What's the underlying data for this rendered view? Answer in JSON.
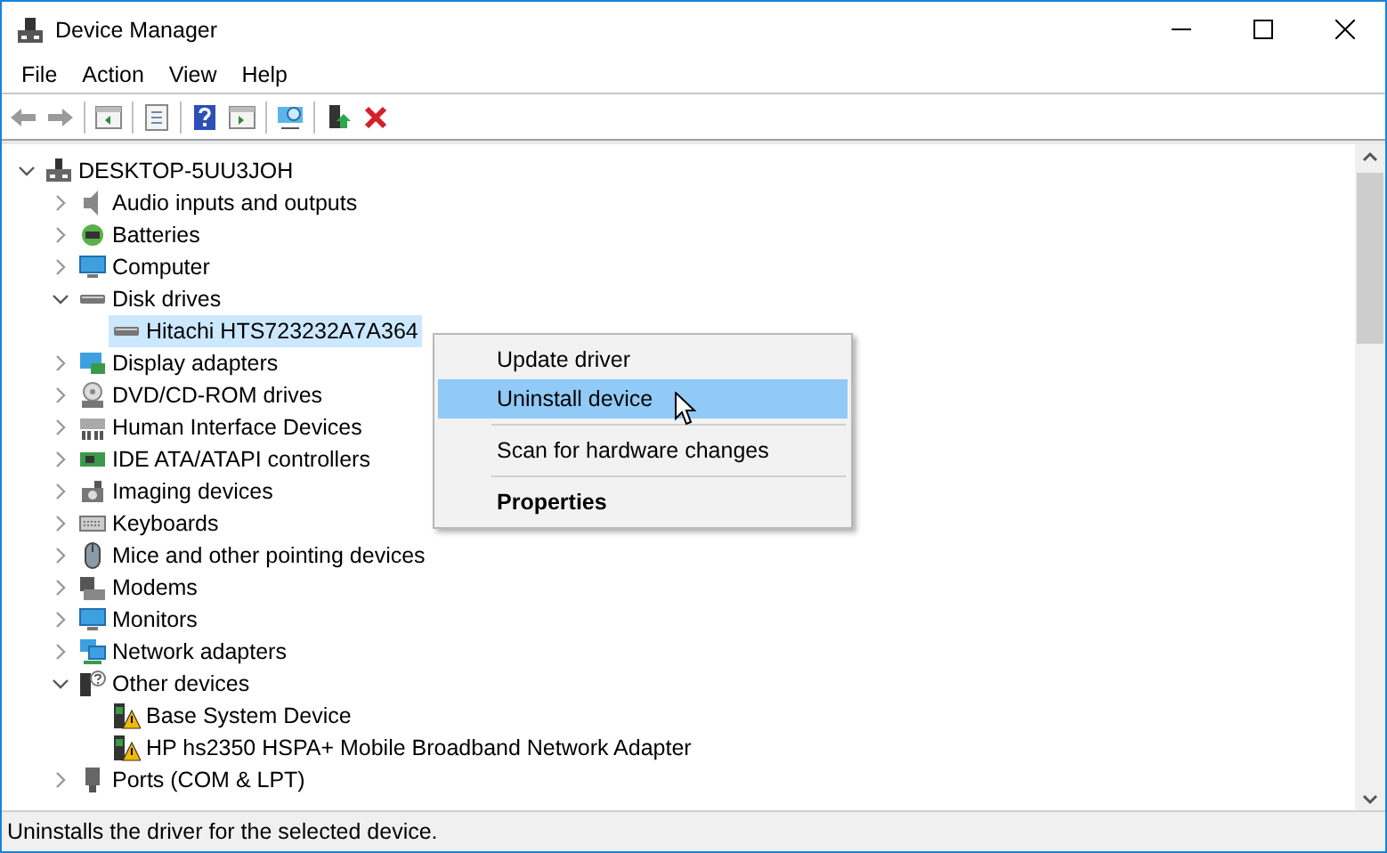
{
  "window": {
    "title": "Device Manager"
  },
  "menu": [
    {
      "label": "File"
    },
    {
      "label": "Action"
    },
    {
      "label": "View"
    },
    {
      "label": "Help"
    }
  ],
  "tree": {
    "label": "DESKTOP-5UU3JOH",
    "expanded": true,
    "selected": false,
    "children": [
      {
        "label": "Audio inputs and outputs",
        "expanded": false,
        "selected": false
      },
      {
        "label": "Batteries",
        "expanded": false,
        "selected": false
      },
      {
        "label": "Computer",
        "expanded": false,
        "selected": false
      },
      {
        "label": "Disk drives",
        "expanded": true,
        "selected": false,
        "children": [
          {
            "label": "Hitachi HTS723232A7A364",
            "selected": true
          }
        ]
      },
      {
        "label": "Display adapters",
        "expanded": false,
        "selected": false
      },
      {
        "label": "DVD/CD-ROM drives",
        "expanded": false,
        "selected": false
      },
      {
        "label": "Human Interface Devices",
        "expanded": false,
        "selected": false
      },
      {
        "label": "IDE ATA/ATAPI controllers",
        "expanded": false,
        "selected": false
      },
      {
        "label": "Imaging devices",
        "expanded": false,
        "selected": false
      },
      {
        "label": "Keyboards",
        "expanded": false,
        "selected": false
      },
      {
        "label": "Mice and other pointing devices",
        "expanded": false,
        "selected": false
      },
      {
        "label": "Modems",
        "expanded": false,
        "selected": false
      },
      {
        "label": "Monitors",
        "expanded": false,
        "selected": false
      },
      {
        "label": "Network adapters",
        "expanded": false,
        "selected": false
      },
      {
        "label": "Other devices",
        "expanded": true,
        "selected": false,
        "children": [
          {
            "label": "Base System Device",
            "selected": false
          },
          {
            "label": "HP hs2350 HSPA+ Mobile Broadband Network Adapter",
            "selected": false
          }
        ]
      },
      {
        "label": "Ports (COM & LPT)",
        "expanded": false,
        "selected": false
      }
    ]
  },
  "context_menu": [
    {
      "kind": "item",
      "label": "Update driver",
      "selected": false
    },
    {
      "kind": "item",
      "label": "Uninstall device",
      "selected": true
    },
    {
      "kind": "separator"
    },
    {
      "kind": "item",
      "label": "Scan for hardware changes",
      "selected": false
    },
    {
      "kind": "separator"
    },
    {
      "kind": "default",
      "label": "Properties",
      "selected": false
    }
  ],
  "status_bar": {
    "text": "Uninstalls the driver for the selected device."
  }
}
